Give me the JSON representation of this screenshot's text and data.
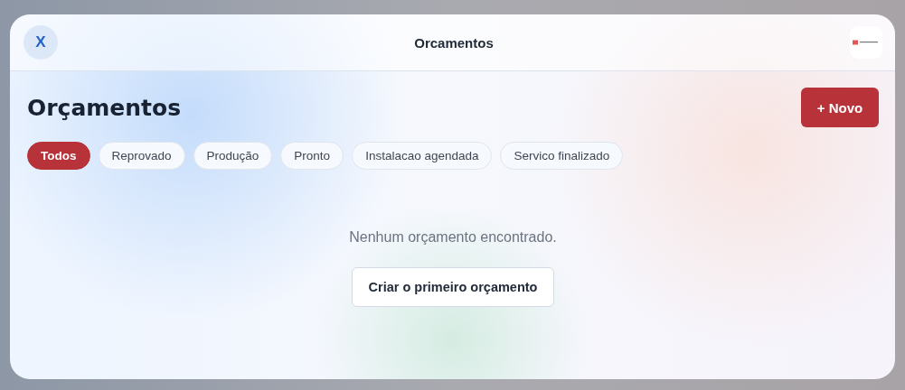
{
  "header": {
    "close": "X",
    "title": "Orcamentos"
  },
  "page": {
    "heading": "Orçamentos",
    "new_button": "+ Novo"
  },
  "filters": [
    {
      "label": "Todos",
      "selected": true
    },
    {
      "label": "Reprovado",
      "selected": false
    },
    {
      "label": "Produção",
      "selected": false
    },
    {
      "label": "Pronto",
      "selected": false
    },
    {
      "label": "Instalacao agendada",
      "selected": false
    },
    {
      "label": "Servico finalizado",
      "selected": false
    }
  ],
  "empty_state": {
    "message": "Nenhum orçamento encontrado.",
    "button": "Criar o primeiro orçamento"
  }
}
